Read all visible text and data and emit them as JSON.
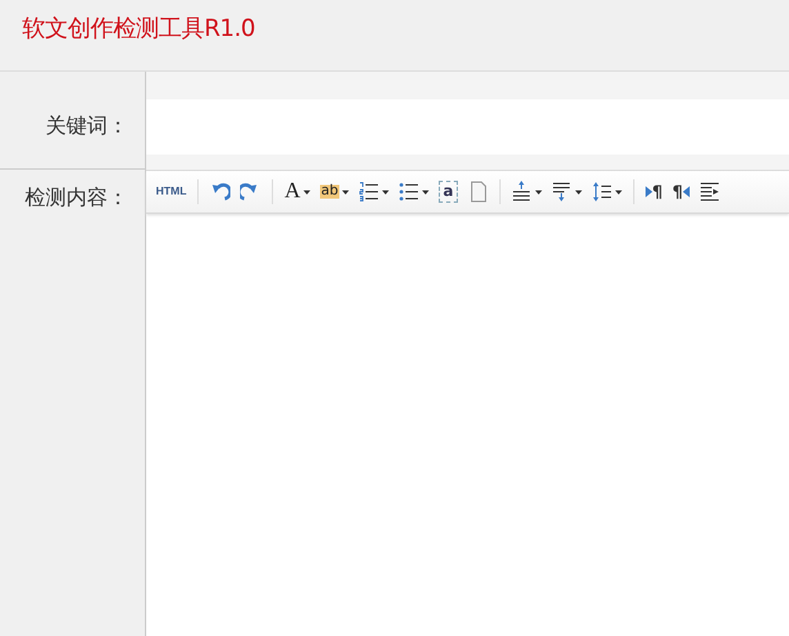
{
  "header": {
    "title": "软文创作检测工具R1.0"
  },
  "form": {
    "keyword_label": "关键词：",
    "content_label": "检测内容："
  },
  "toolbar": [
    {
      "kind": "text",
      "label": "HTML",
      "dropdown": false
    },
    {
      "kind": "separator"
    },
    {
      "kind": "undo",
      "dropdown": false
    },
    {
      "kind": "redo",
      "dropdown": false
    },
    {
      "kind": "separator"
    },
    {
      "kind": "fontcolor",
      "label": "A",
      "dropdown": true
    },
    {
      "kind": "highlight",
      "label": "ab",
      "dropdown": true
    },
    {
      "kind": "olist",
      "dropdown": true
    },
    {
      "kind": "ulist",
      "dropdown": true
    },
    {
      "kind": "boxed",
      "label": "a",
      "dropdown": false
    },
    {
      "kind": "page",
      "dropdown": false
    },
    {
      "kind": "separator"
    },
    {
      "kind": "spacetop",
      "dropdown": true
    },
    {
      "kind": "spacebottom",
      "dropdown": true
    },
    {
      "kind": "lineheight",
      "dropdown": true
    },
    {
      "kind": "separator"
    },
    {
      "kind": "ltr",
      "label": "¶",
      "dropdown": false
    },
    {
      "kind": "rtl",
      "label": "¶",
      "dropdown": false
    },
    {
      "kind": "indent",
      "dropdown": false
    }
  ]
}
